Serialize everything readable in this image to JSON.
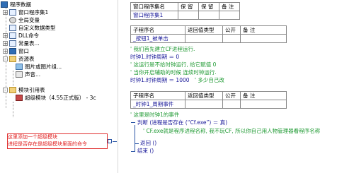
{
  "tree": {
    "root": "程序数据",
    "items": [
      {
        "label": "窗口程序集1",
        "expander": "+"
      },
      {
        "label": "全局变量"
      },
      {
        "label": "自定义数据类型"
      },
      {
        "label": "DLL命令",
        "expander": "+"
      },
      {
        "label": "常量表...",
        "expander": "+"
      },
      {
        "label": "窗口",
        "expander": "+"
      },
      {
        "label": "资源表",
        "expander": "-"
      },
      {
        "label": "图片或图片组..."
      },
      {
        "label": "声音..."
      },
      {
        "label": "模块引用表",
        "expander": "-"
      },
      {
        "label": "超级模块（4.55正式版） - 3c"
      }
    ],
    "note_line1": "这里添加一个超级模块",
    "note_line2": "进程是否存在是超级模块里面的命令"
  },
  "assembly_table": {
    "headers": [
      "窗口程序集名",
      "保 留",
      "保 留",
      "备 注"
    ],
    "values": [
      "窗口程序集1",
      "",
      "",
      ""
    ]
  },
  "sub1_table": {
    "headers": [
      "子程序名",
      "返回值类型",
      "公开",
      "备 注"
    ],
    "values": [
      "_按钮1_被单击",
      "",
      "",
      ""
    ]
  },
  "code1": {
    "comment1": "' 我们首先建立CF进程运行.",
    "line1": "时钟1.时钟周期 ＝ 0",
    "comment2": "' 这运行是不给时钟运行, 给它赋值 0",
    "comment3": "' 当你开启辅助的时候 连续时钟运行.",
    "line2": "时钟1.时钟周期 ＝ 1000",
    "line2_comment": "' 多少自己改"
  },
  "sub2_table": {
    "headers": [
      "子程序名",
      "返回值类型",
      "公开",
      "备 注"
    ],
    "values": [
      "_时钟1_周期事件",
      "",
      "",
      ""
    ]
  },
  "code2": {
    "comment1": "' 这里是时钟1的事件",
    "if_line": "判断 (进程是否存在 (“Cf.exe”) ＝ 真)",
    "if_comment": "' CF.exe就是程序进程名称, 我不玩CF, 所以你自己用人物管理器看程序名称",
    "return": "返回 ()",
    "end": "结束 ()"
  }
}
